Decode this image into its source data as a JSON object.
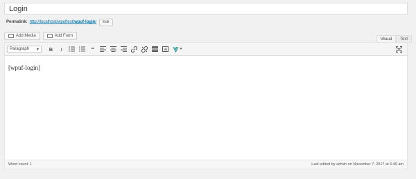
{
  "post": {
    "title": "Login"
  },
  "permalink": {
    "label": "Permalink:",
    "url_base": "http://localhost/wpuftest/",
    "slug": "wpuf-login",
    "url_end": "/",
    "edit_label": "Edit"
  },
  "media_buttons": {
    "add_media": "Add Media",
    "add_form": "Add Form"
  },
  "tabs": {
    "visual": "Visual",
    "text": "Text",
    "active": "visual"
  },
  "toolbar": {
    "format_select": "Paragraph",
    "buttons": [
      "bold-icon",
      "italic-icon",
      "bulleted-list-icon",
      "numbered-list-icon",
      "blockquote-icon",
      "align-left-icon",
      "align-center-icon",
      "align-right-icon",
      "insert-link-icon",
      "remove-link-icon",
      "read-more-icon",
      "toolbar-toggle-icon",
      "plugin-icon",
      "fullscreen-icon"
    ],
    "bold": "B",
    "italic": "I",
    "blockquote": "❝"
  },
  "editor": {
    "content": "[wpuf-login]"
  },
  "status": {
    "word_count": "Word count: 1",
    "last_edited": "Last edited by admin on November 7, 2017 at 6:49 am"
  }
}
